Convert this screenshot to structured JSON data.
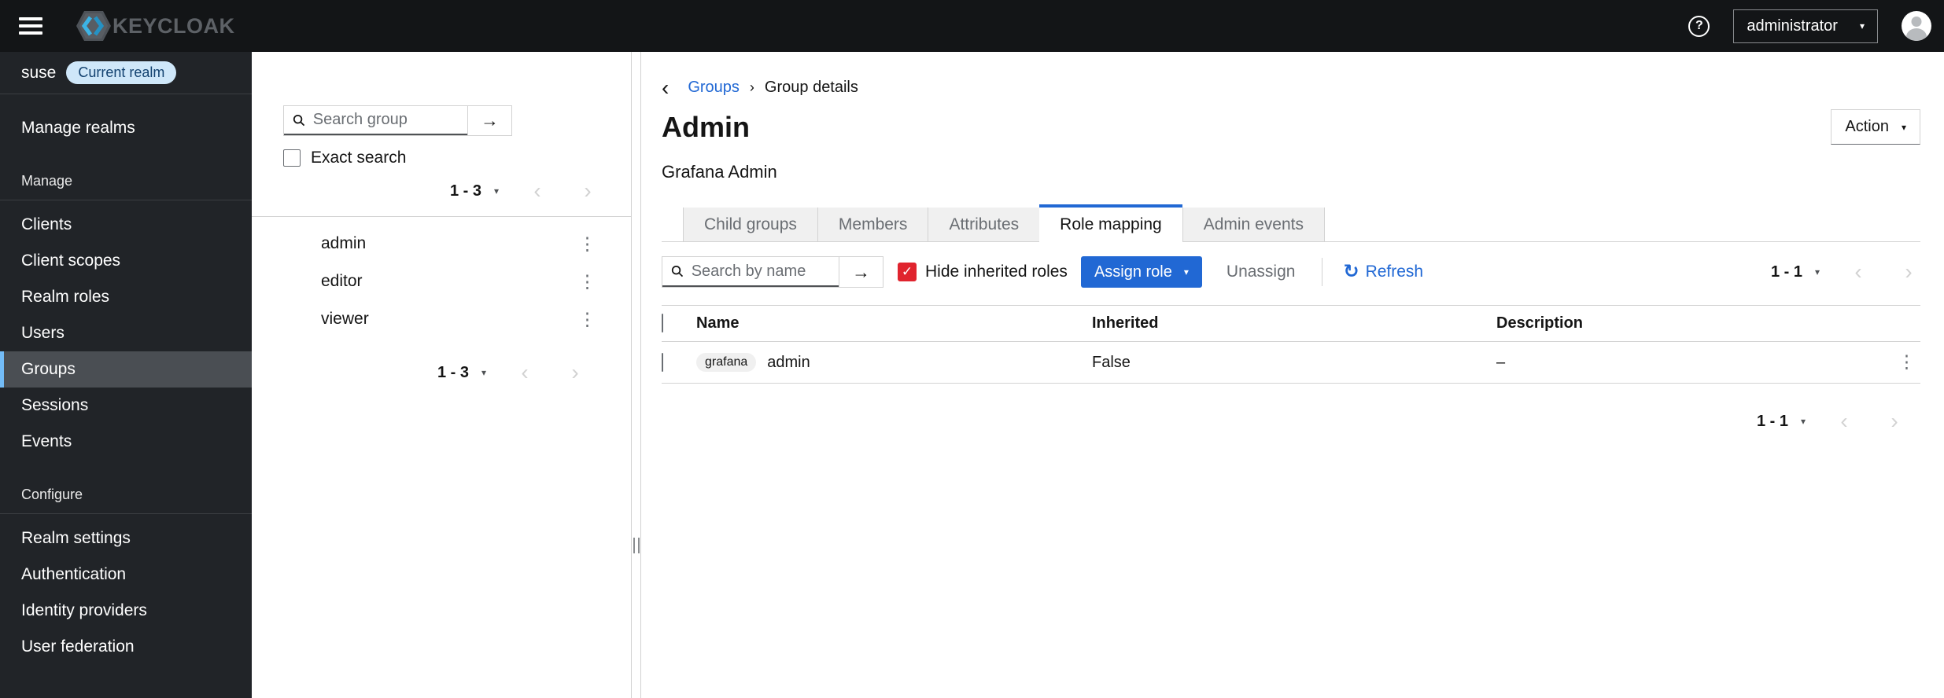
{
  "colors": {
    "accent_blue": "#2168d4",
    "checkbox_checked_red": "#e0242e",
    "sidebar_bg": "#212428",
    "topbar_bg": "#131517",
    "selected_nav_indicator": "#73bcf7",
    "realm_badge_bg": "#cfe7f9",
    "realm_badge_text": "#12416f"
  },
  "glyphs": {
    "question": "?",
    "caret_down": "▾",
    "arrow_right": "→",
    "chevron_left": "‹",
    "chevron_right": "›",
    "back_chevron": "‹",
    "breadcrumb_sep": "›",
    "kebab": "⋮",
    "check": "✓",
    "refresh": "↻"
  },
  "topbar": {
    "brand": "KEYCLOAK",
    "user": "administrator"
  },
  "sidebar": {
    "realm_name": "suse",
    "realm_badge": "Current realm",
    "manage_realms_label": "Manage realms",
    "manage_section_label": "Manage",
    "manage_items": [
      "Clients",
      "Client scopes",
      "Realm roles",
      "Users",
      "Groups",
      "Sessions",
      "Events"
    ],
    "selected_item": "Groups",
    "configure_section_label": "Configure",
    "configure_items": [
      "Realm settings",
      "Authentication",
      "Identity providers",
      "User federation"
    ]
  },
  "groups_panel": {
    "search_placeholder": "Search group",
    "exact_search_label": "Exact search",
    "exact_search_checked": false,
    "top_range": "1 - 3",
    "groups": [
      "admin",
      "editor",
      "viewer"
    ],
    "bottom_range": "1 - 3"
  },
  "main": {
    "breadcrumb_link": "Groups",
    "breadcrumb_current": "Group details",
    "title": "Admin",
    "subtitle": "Grafana Admin",
    "action_label": "Action",
    "tabs": [
      "Child groups",
      "Members",
      "Attributes",
      "Role mapping",
      "Admin events"
    ],
    "active_tab": "Role mapping",
    "toolbar": {
      "search_placeholder": "Search by name",
      "hide_inherited_label": "Hide inherited roles",
      "hide_inherited_checked": true,
      "assign_label": "Assign role",
      "unassign_label": "Unassign",
      "refresh_label": "Refresh",
      "range": "1 - 1"
    },
    "table": {
      "columns": [
        "Name",
        "Inherited",
        "Description"
      ],
      "row": {
        "client_badge": "grafana",
        "name": "admin",
        "inherited": "False",
        "description": "–"
      }
    },
    "bottom_range": "1 - 1"
  }
}
